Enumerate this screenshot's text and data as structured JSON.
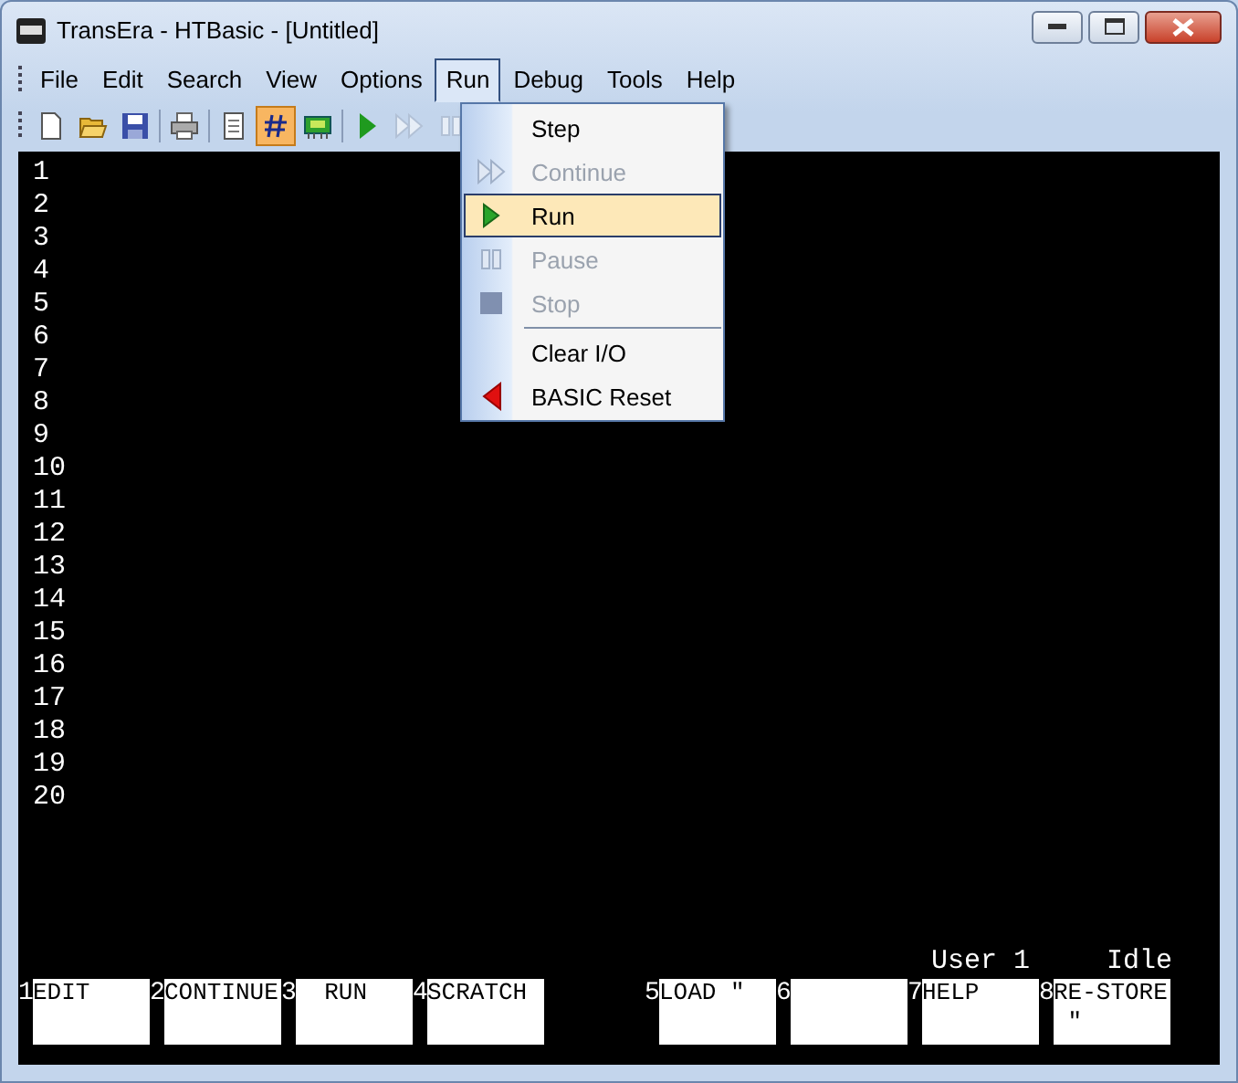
{
  "window": {
    "title": "TransEra - HTBasic - [Untitled]"
  },
  "menu_bar": [
    {
      "label": "File",
      "selected": false
    },
    {
      "label": "Edit",
      "selected": false
    },
    {
      "label": "Search",
      "selected": false
    },
    {
      "label": "View",
      "selected": false
    },
    {
      "label": "Options",
      "selected": false
    },
    {
      "label": "Run",
      "selected": true
    },
    {
      "label": "Debug",
      "selected": false
    },
    {
      "label": "Tools",
      "selected": false
    },
    {
      "label": "Help",
      "selected": false
    }
  ],
  "toolbar": [
    {
      "kind": "new",
      "pressed": false,
      "disabled": false
    },
    {
      "kind": "open",
      "pressed": false,
      "disabled": false
    },
    {
      "kind": "save",
      "pressed": false,
      "disabled": false
    },
    {
      "kind": "separator"
    },
    {
      "kind": "print",
      "pressed": false,
      "disabled": false
    },
    {
      "kind": "separator"
    },
    {
      "kind": "edit",
      "pressed": false,
      "disabled": false
    },
    {
      "kind": "line-numbers",
      "pressed": true,
      "disabled": false
    },
    {
      "kind": "board",
      "pressed": false,
      "disabled": false
    },
    {
      "kind": "separator"
    },
    {
      "kind": "run",
      "pressed": false,
      "disabled": false
    },
    {
      "kind": "continue",
      "pressed": false,
      "disabled": true
    },
    {
      "kind": "pause",
      "pressed": false,
      "disabled": true
    }
  ],
  "run_menu": [
    {
      "kind": "step",
      "label": "Step",
      "disabled": false,
      "selected": false
    },
    {
      "kind": "continue",
      "label": "Continue",
      "disabled": true,
      "selected": false
    },
    {
      "kind": "run",
      "label": "Run",
      "disabled": false,
      "selected": true
    },
    {
      "kind": "pause",
      "label": "Pause",
      "disabled": true,
      "selected": false
    },
    {
      "kind": "stop",
      "label": "Stop",
      "disabled": true,
      "selected": false
    },
    {
      "kind": "separator"
    },
    {
      "kind": "clear",
      "label": "Clear I/O",
      "disabled": false,
      "selected": false
    },
    {
      "kind": "reset",
      "label": "BASIC Reset",
      "disabled": false,
      "selected": false
    }
  ],
  "editor": {
    "line_numbers": [
      "1",
      "2",
      "3",
      "4",
      "5",
      "6",
      "7",
      "8",
      "9",
      "10",
      "11",
      "12",
      "13",
      "14",
      "15",
      "16",
      "17",
      "18",
      "19",
      "20"
    ]
  },
  "status": {
    "user": "User 1",
    "state": "Idle"
  },
  "softkeys": [
    {
      "number": "1",
      "lines": [
        "EDIT"
      ]
    },
    {
      "number": "2",
      "lines": [
        "CONTINUE"
      ]
    },
    {
      "number": "3",
      "lines": [
        "  RUN"
      ]
    },
    {
      "number": "4",
      "lines": [
        "SCRATCH"
      ]
    },
    {
      "number": "5",
      "lines": [
        "LOAD ″"
      ]
    },
    {
      "number": "6"
    },
    {
      "number": "7",
      "lines": [
        "HELP"
      ]
    },
    {
      "number": "8",
      "lines": [
        "RE-STORE",
        " ″"
      ]
    }
  ]
}
